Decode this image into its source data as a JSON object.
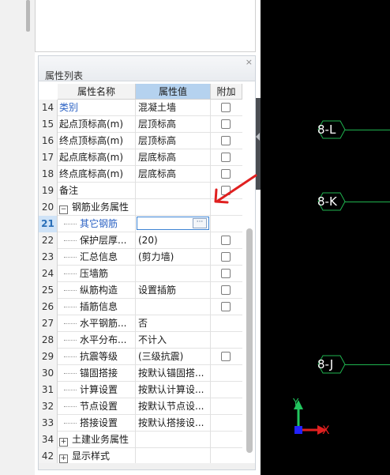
{
  "panel": {
    "title": "属性列表",
    "close_glyph": "×",
    "columns": {
      "name": "属性名称",
      "value": "属性值",
      "extra": "附加"
    }
  },
  "rows": [
    {
      "num": "14",
      "name": "类别",
      "value": "混凝土墙",
      "checkbox": true,
      "style": "blue"
    },
    {
      "num": "15",
      "name": "起点顶标高(m)",
      "value": "层顶标高",
      "checkbox": true
    },
    {
      "num": "16",
      "name": "终点顶标高(m)",
      "value": "层顶标高",
      "checkbox": true
    },
    {
      "num": "17",
      "name": "起点底标高(m)",
      "value": "层底标高",
      "checkbox": true
    },
    {
      "num": "18",
      "name": "终点底标高(m)",
      "value": "层底标高",
      "checkbox": true
    },
    {
      "num": "19",
      "name": "备注",
      "value": "",
      "checkbox": true
    },
    {
      "num": "20",
      "name": "钢筋业务属性",
      "value": "",
      "checkbox": false,
      "expander": "−"
    },
    {
      "num": "21",
      "name": "其它钢筋",
      "value": "",
      "checkbox": false,
      "style": "blue",
      "child": true,
      "editing": true,
      "edit_button": "···"
    },
    {
      "num": "22",
      "name": "保护层厚...",
      "value": "(20)",
      "checkbox": true,
      "child": true
    },
    {
      "num": "23",
      "name": "汇总信息",
      "value": "(剪力墙)",
      "checkbox": true,
      "child": true
    },
    {
      "num": "24",
      "name": "压墙筋",
      "value": "",
      "checkbox": true,
      "child": true
    },
    {
      "num": "25",
      "name": "纵筋构造",
      "value": "设置插筋",
      "checkbox": true,
      "child": true
    },
    {
      "num": "26",
      "name": "插筋信息",
      "value": "",
      "checkbox": true,
      "child": true
    },
    {
      "num": "27",
      "name": "水平钢筋...",
      "value": "否",
      "checkbox": false,
      "child": true
    },
    {
      "num": "28",
      "name": "水平分布...",
      "value": "不计入",
      "checkbox": false,
      "child": true
    },
    {
      "num": "29",
      "name": "抗震等级",
      "value": "(三级抗震)",
      "checkbox": true,
      "child": true
    },
    {
      "num": "30",
      "name": "锚固搭接",
      "value": "按默认锚固搭...",
      "checkbox": false,
      "child": true
    },
    {
      "num": "31",
      "name": "计算设置",
      "value": "按默认计算设...",
      "checkbox": false,
      "child": true
    },
    {
      "num": "32",
      "name": "节点设置",
      "value": "按默认节点设...",
      "checkbox": false,
      "child": true
    },
    {
      "num": "33",
      "name": "搭接设置",
      "value": "按默认搭接设...",
      "checkbox": false,
      "child": true
    },
    {
      "num": "34",
      "name": "土建业务属性",
      "value": "",
      "checkbox": false,
      "expander": "+"
    },
    {
      "num": "42",
      "name": "显示样式",
      "value": "",
      "checkbox": false,
      "expander": "+"
    }
  ],
  "canvas": {
    "axis_labels": [
      "8-L",
      "8-K",
      "8-J"
    ],
    "ucs": {
      "y_label": "Y",
      "x_label": "X"
    },
    "colors": {
      "background": "#000000",
      "axis_line": "#1fb34f",
      "y_axis": "#22c55e",
      "x_axis": "#e02020",
      "origin": "#2222ff"
    }
  },
  "colors": {
    "accent_blue": "#2b62c4",
    "header_value_bg": "#b5d2ef",
    "annotation_arrow": "#e02020"
  }
}
